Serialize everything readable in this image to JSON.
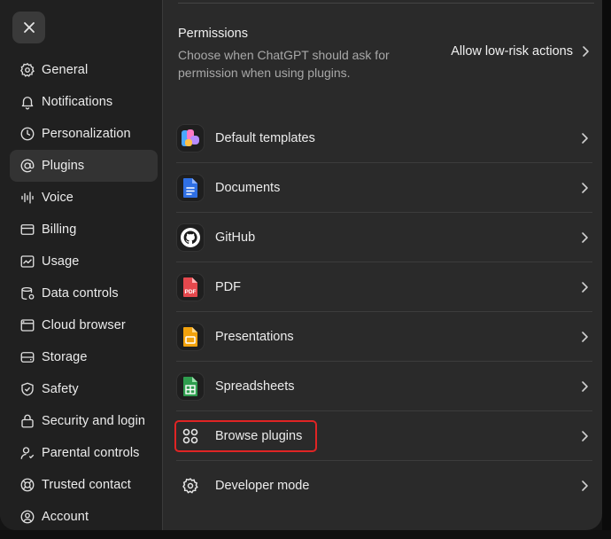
{
  "sidebar": {
    "close_icon": "close-icon",
    "items": [
      {
        "label": "General",
        "icon": "gear-icon"
      },
      {
        "label": "Notifications",
        "icon": "bell-icon"
      },
      {
        "label": "Personalization",
        "icon": "personalization-icon"
      },
      {
        "label": "Plugins",
        "icon": "at-sign-icon",
        "active": true
      },
      {
        "label": "Voice",
        "icon": "waveform-icon"
      },
      {
        "label": "Billing",
        "icon": "credit-card-icon"
      },
      {
        "label": "Usage",
        "icon": "chart-icon"
      },
      {
        "label": "Data controls",
        "icon": "database-icon"
      },
      {
        "label": "Cloud browser",
        "icon": "browser-icon"
      },
      {
        "label": "Storage",
        "icon": "storage-icon"
      },
      {
        "label": "Safety",
        "icon": "shield-icon"
      },
      {
        "label": "Security and login",
        "icon": "lock-icon"
      },
      {
        "label": "Parental controls",
        "icon": "person-icon"
      },
      {
        "label": "Trusted contact",
        "icon": "lifebuoy-icon"
      },
      {
        "label": "Account",
        "icon": "account-icon"
      }
    ]
  },
  "permissions": {
    "title": "Permissions",
    "description": "Choose when ChatGPT should ask for permission when using plugins.",
    "action_label": "Allow low-risk actions"
  },
  "plugins": [
    {
      "label": "Default templates",
      "icon": "templates-icon"
    },
    {
      "label": "Documents",
      "icon": "documents-icon"
    },
    {
      "label": "GitHub",
      "icon": "github-icon"
    },
    {
      "label": "PDF",
      "icon": "pdf-icon",
      "icon_text": "PDF"
    },
    {
      "label": "Presentations",
      "icon": "presentations-icon"
    },
    {
      "label": "Spreadsheets",
      "icon": "spreadsheets-icon"
    },
    {
      "label": "Browse plugins",
      "icon": "grid-icon",
      "highlighted": true
    },
    {
      "label": "Developer mode",
      "icon": "gear-icon"
    }
  ],
  "colors": {
    "highlight": "#e02424",
    "documents_blue": "#2f6fe4",
    "pdf_red": "#e5484d",
    "presentations_orange": "#f2a20c",
    "spreadsheets_green": "#2e9d4e"
  }
}
